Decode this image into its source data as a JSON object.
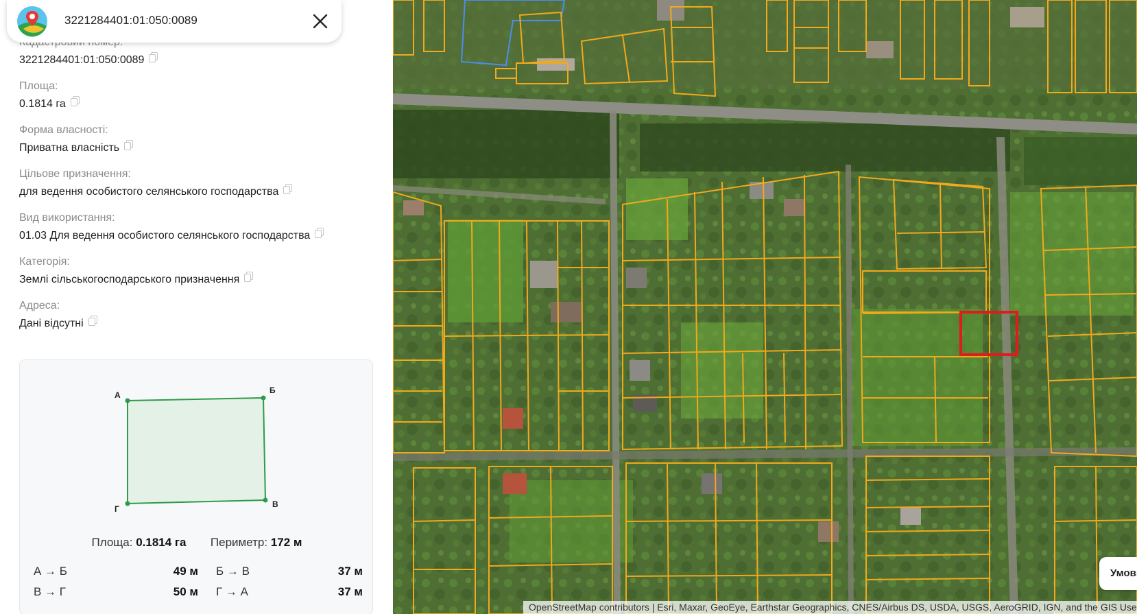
{
  "search": {
    "value": "3221284401:01:050:0089"
  },
  "fields": [
    {
      "label": "Кадастровий номер:",
      "value": "3221284401:01:050:0089"
    },
    {
      "label": "Площа:",
      "value": "0.1814 га"
    },
    {
      "label": "Форма власності:",
      "value": "Приватна власність"
    },
    {
      "label": "Цільове призначення:",
      "value": "для ведення особистого селянського господарства"
    },
    {
      "label": "Вид використання:",
      "value": "01.03 Для ведення особистого селянського господарства"
    },
    {
      "label": "Категорія:",
      "value": "Землі сільськогосподарського призначення"
    },
    {
      "label": "Адреса:",
      "value": "Дані відсутні"
    }
  ],
  "shape": {
    "vertices": [
      {
        "name": "А"
      },
      {
        "name": "Б"
      },
      {
        "name": "В"
      },
      {
        "name": "Г"
      }
    ],
    "area_label": "Площа:",
    "area_value": "0.1814 га",
    "perimeter_label": "Периметр:",
    "perimeter_value": "172 м",
    "sides": [
      {
        "label": "А → Б",
        "length": "49 м"
      },
      {
        "label": "Б → В",
        "length": "37 м"
      },
      {
        "label": "В → Г",
        "length": "50 м"
      },
      {
        "label": "Г → А",
        "length": "37 м"
      }
    ]
  },
  "map": {
    "terms_button": "Умови",
    "attribution": "OpenStreetMap contributors | Esri, Maxar, GeoEye, Earthstar Geographics, CNES/Airbus DS, USDA, USGS, AeroGRID, IGN, and the GIS User Community"
  },
  "colors": {
    "parcel_outline": "#f2a91c",
    "selected_parcel": "#e01b1b",
    "shape_stroke": "#2e9a4a",
    "shape_fill": "#e3f1e7"
  },
  "icons": {
    "logo": "cadastre-map-logo",
    "close": "close-icon",
    "copy": "copy-icon"
  }
}
